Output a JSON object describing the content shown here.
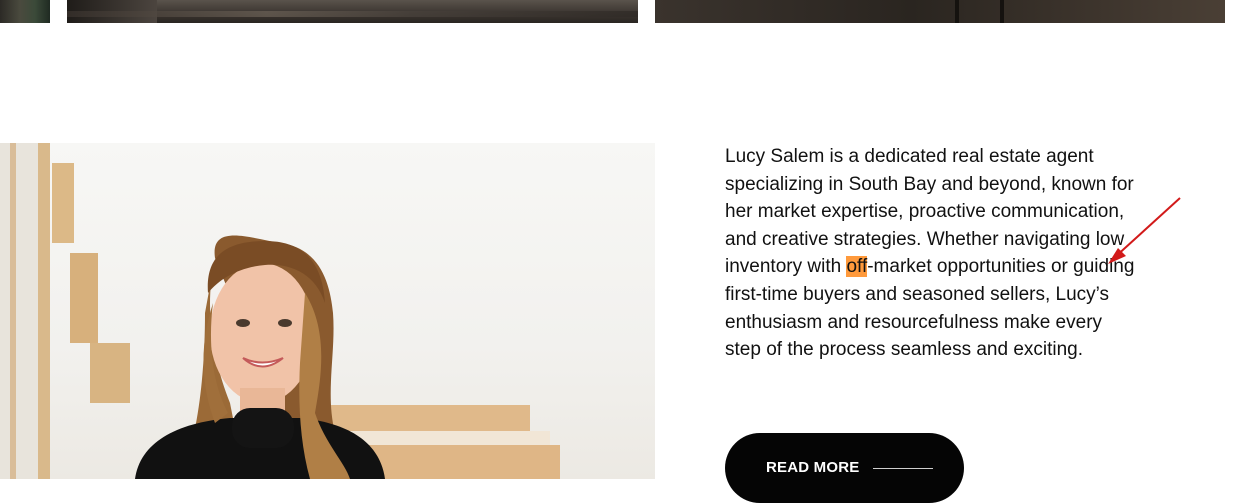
{
  "profile": {
    "bio_before": "Lucy Salem is a dedicated real estate agent specializing in South Bay and beyond, known for her market expertise, proactive communication, and creative strategies. Whether navigating low inventory with ",
    "bio_highlight": "off",
    "bio_after": "-market opportunities or guiding first-time buyers and seasoned sellers, Lucy’s enthusiasm and resourcefulness make every step of the process seamless and exciting.",
    "highlight_color": "#ff9a3c",
    "annotation_color": "#d21a1a",
    "read_more_label": "READ MORE",
    "read_more_icon": "long-arrow-line-icon"
  }
}
